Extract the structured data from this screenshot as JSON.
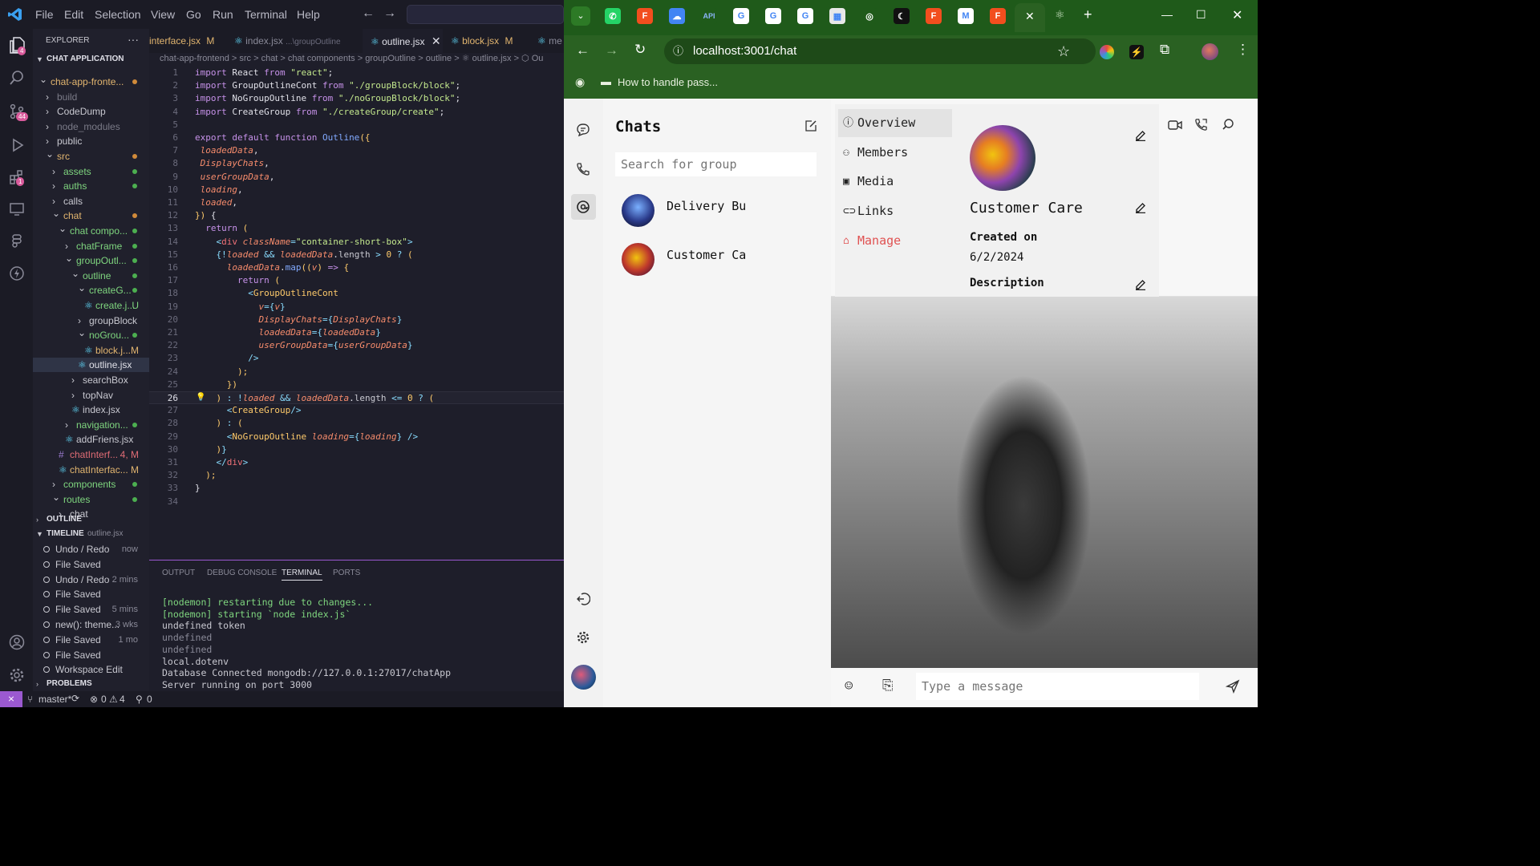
{
  "vscode": {
    "menu": [
      "File",
      "Edit",
      "Selection",
      "View",
      "Go",
      "Run",
      "Terminal",
      "Help"
    ],
    "activity_badges": {
      "explorer": "4",
      "source_control": "44",
      "extensions": "1"
    },
    "explorer": {
      "title": "EXPLORER",
      "more": "···",
      "workspace": "CHAT APPLICATION",
      "tree": [
        {
          "label": "chat-app-fronte...",
          "indent": 0,
          "open": true,
          "dot": "#d08a3a",
          "color": "#e2b56f"
        },
        {
          "label": "build",
          "indent": 1,
          "open": false,
          "dot": "",
          "color": "#7b7b88"
        },
        {
          "label": "CodeDump",
          "indent": 1,
          "open": false,
          "dot": "",
          "color": "#c8c8d0"
        },
        {
          "label": "node_modules",
          "indent": 1,
          "open": false,
          "dot": "",
          "color": "#7b7b88"
        },
        {
          "label": "public",
          "indent": 1,
          "open": false,
          "dot": "",
          "color": "#c8c8d0"
        },
        {
          "label": "src",
          "indent": 1,
          "open": true,
          "dot": "#d08a3a",
          "color": "#e2b56f"
        },
        {
          "label": "assets",
          "indent": 2,
          "open": false,
          "dot": "#4caf50",
          "color": "#7fd67f"
        },
        {
          "label": "auths",
          "indent": 2,
          "open": false,
          "dot": "#4caf50",
          "color": "#7fd67f"
        },
        {
          "label": "calls",
          "indent": 2,
          "open": false,
          "dot": "",
          "color": "#c8c8d0"
        },
        {
          "label": "chat",
          "indent": 2,
          "open": true,
          "dot": "#d08a3a",
          "color": "#e2b56f"
        },
        {
          "label": "chat compo...",
          "indent": 3,
          "open": true,
          "dot": "#4caf50",
          "color": "#7fd67f"
        },
        {
          "label": "chatFrame",
          "indent": 4,
          "open": false,
          "dot": "#4caf50",
          "color": "#7fd67f"
        },
        {
          "label": "groupOutl...",
          "indent": 4,
          "open": true,
          "dot": "#4caf50",
          "color": "#7fd67f"
        },
        {
          "label": "outline",
          "indent": 5,
          "open": true,
          "dot": "#4caf50",
          "color": "#7fd67f"
        },
        {
          "label": "createG...",
          "indent": 6,
          "open": true,
          "dot": "#4caf50",
          "color": "#7fd67f"
        },
        {
          "label": "create.j...",
          "indent": 7,
          "file": true,
          "badge": "U",
          "color": "#7fd67f"
        },
        {
          "label": "groupBlock",
          "indent": 6,
          "open": false,
          "dot": "",
          "color": "#c8c8d0"
        },
        {
          "label": "noGrou...",
          "indent": 6,
          "open": true,
          "dot": "#4caf50",
          "color": "#7fd67f"
        },
        {
          "label": "block.j...",
          "indent": 7,
          "file": true,
          "badge": "M",
          "color": "#e2b56f"
        },
        {
          "label": "outline.jsx",
          "indent": 6,
          "file": true,
          "badge": "",
          "color": "#e0e0e8",
          "selected": true
        },
        {
          "label": "searchBox",
          "indent": 5,
          "open": false,
          "dot": "",
          "color": "#c8c8d0"
        },
        {
          "label": "topNav",
          "indent": 5,
          "open": false,
          "dot": "",
          "color": "#c8c8d0"
        },
        {
          "label": "index.jsx",
          "indent": 5,
          "file": true,
          "badge": "",
          "color": "#c8c8d0"
        },
        {
          "label": "navigation...",
          "indent": 4,
          "open": false,
          "dot": "#4caf50",
          "color": "#7fd67f"
        },
        {
          "label": "addFriens.jsx",
          "indent": 4,
          "file": true,
          "badge": "",
          "color": "#c8c8d0"
        },
        {
          "label": "chatInterf...",
          "indent": 3,
          "file": true,
          "badge": "4, M",
          "color": "#e06c75",
          "hash": true
        },
        {
          "label": "chatInterfac...",
          "indent": 3,
          "file": true,
          "badge": "M",
          "color": "#e2b56f"
        },
        {
          "label": "components",
          "indent": 2,
          "open": false,
          "dot": "#4caf50",
          "color": "#7fd67f"
        },
        {
          "label": "routes",
          "indent": 2,
          "open": true,
          "dot": "#4caf50",
          "color": "#7fd67f"
        },
        {
          "label": "chat",
          "indent": 3,
          "open": false,
          "dot": "",
          "color": "#c8c8d0"
        }
      ],
      "outline": "OUTLINE",
      "timeline": "TIMELINE",
      "timeline_file": "outline.jsx",
      "timeline_items": [
        {
          "text": "Undo / Redo",
          "time": "now"
        },
        {
          "text": "File Saved",
          "time": ""
        },
        {
          "text": "Undo / Redo",
          "time": "2 mins"
        },
        {
          "text": "File Saved",
          "time": ""
        },
        {
          "text": "File Saved",
          "time": "5 mins"
        },
        {
          "text": "new(): theme...",
          "time": "3 wks"
        },
        {
          "text": "File Saved",
          "time": "1 mo"
        },
        {
          "text": "File Saved",
          "time": ""
        },
        {
          "text": "Workspace Edit",
          "time": ""
        }
      ],
      "problems": "PROBLEMS"
    },
    "tabs": [
      {
        "label": "interface.jsx",
        "suffix": "M",
        "active": false
      },
      {
        "label": "index.jsx",
        "suffix": "...\\groupOutline",
        "active": false
      },
      {
        "label": "outline.jsx",
        "suffix": "",
        "active": true
      },
      {
        "label": "block.jsx",
        "suffix": "M",
        "active": false
      },
      {
        "label": "me",
        "suffix": "",
        "active": false
      }
    ],
    "breadcrumb": "chat-app-frontend > src > chat > chat components > groupOutline > outline > ⚛ outline.jsx > ⬡ Ou",
    "code": [
      [
        [
          "kw",
          "import"
        ],
        [
          "p",
          " React "
        ],
        [
          "kw",
          "from"
        ],
        [
          "s",
          " \"react\""
        ],
        [
          "p",
          ";"
        ]
      ],
      [
        [
          "kw",
          "import"
        ],
        [
          "p",
          " GroupOutlineCont "
        ],
        [
          "kw",
          "from"
        ],
        [
          "s",
          " \"./groupBlock/block\""
        ],
        [
          "p",
          ";"
        ]
      ],
      [
        [
          "kw",
          "import"
        ],
        [
          "p",
          " NoGroupOutline "
        ],
        [
          "kw",
          "from"
        ],
        [
          "s",
          " \"./noGroupBlock/block\""
        ],
        [
          "p",
          ";"
        ]
      ],
      [
        [
          "kw",
          "import"
        ],
        [
          "p",
          " CreateGroup "
        ],
        [
          "kw",
          "from"
        ],
        [
          "s",
          " \"./createGroup/create\""
        ],
        [
          "p",
          ";"
        ]
      ],
      [],
      [
        [
          "kw",
          "export default function"
        ],
        [
          "f",
          " Outline"
        ],
        [
          "t",
          "({"
        ]
      ],
      [
        [
          "i",
          " loadedData"
        ],
        [
          "p",
          ","
        ]
      ],
      [
        [
          "i",
          " DisplayChats"
        ],
        [
          "p",
          ","
        ]
      ],
      [
        [
          "i",
          " userGroupData"
        ],
        [
          "p",
          ","
        ]
      ],
      [
        [
          "i",
          " loading"
        ],
        [
          "p",
          ","
        ]
      ],
      [
        [
          "i",
          " loaded"
        ],
        [
          "p",
          ","
        ]
      ],
      [
        [
          "t",
          "})"
        ],
        [
          "p",
          " {"
        ]
      ],
      [
        [
          "kw",
          "  return"
        ],
        [
          "t",
          " ("
        ]
      ],
      [
        [
          "o",
          "    <"
        ],
        [
          "k",
          "div"
        ],
        [
          "i",
          " className"
        ],
        [
          "o",
          "="
        ],
        [
          "s",
          "\"container-short-box\""
        ],
        [
          "o",
          ">"
        ]
      ],
      [
        [
          "c",
          "    {"
        ],
        [
          "o",
          "!"
        ],
        [
          "i",
          "loaded"
        ],
        [
          "o",
          " && "
        ],
        [
          "i",
          "loadedData"
        ],
        [
          "p",
          "."
        ],
        [
          "pl",
          "length"
        ],
        [
          "o",
          " > "
        ],
        [
          "t",
          "0"
        ],
        [
          "o",
          " ? "
        ],
        [
          "t",
          "("
        ]
      ],
      [
        [
          "i",
          "      loadedData"
        ],
        [
          "p",
          "."
        ],
        [
          "f",
          "map"
        ],
        [
          "t",
          "(("
        ],
        [
          "i",
          "v"
        ],
        [
          "t",
          ")"
        ],
        [
          "kw",
          " =>"
        ],
        [
          "t",
          " {"
        ]
      ],
      [
        [
          "kw",
          "        return"
        ],
        [
          "t",
          " ("
        ]
      ],
      [
        [
          "o",
          "          <"
        ],
        [
          "t",
          "GroupOutlineCont"
        ]
      ],
      [
        [
          "i",
          "            v"
        ],
        [
          "o",
          "="
        ],
        [
          "c",
          "{"
        ],
        [
          "i",
          "v"
        ],
        [
          "c",
          "}"
        ]
      ],
      [
        [
          "i",
          "            DisplayChats"
        ],
        [
          "o",
          "="
        ],
        [
          "c",
          "{"
        ],
        [
          "i",
          "DisplayChats"
        ],
        [
          "c",
          "}"
        ]
      ],
      [
        [
          "i",
          "            loadedData"
        ],
        [
          "o",
          "="
        ],
        [
          "c",
          "{"
        ],
        [
          "i",
          "loadedData"
        ],
        [
          "c",
          "}"
        ]
      ],
      [
        [
          "i",
          "            userGroupData"
        ],
        [
          "o",
          "="
        ],
        [
          "c",
          "{"
        ],
        [
          "i",
          "userGroupData"
        ],
        [
          "c",
          "}"
        ]
      ],
      [
        [
          "o",
          "          />"
        ]
      ],
      [
        [
          "t",
          "        );"
        ]
      ],
      [
        [
          "t",
          "      })"
        ]
      ],
      [
        [
          "t",
          "    ) "
        ],
        [
          "o",
          ": !"
        ],
        [
          "i",
          "loaded"
        ],
        [
          "o",
          " && "
        ],
        [
          "i",
          "loadedData"
        ],
        [
          "p",
          "."
        ],
        [
          "pl",
          "length"
        ],
        [
          "o",
          " <= "
        ],
        [
          "t",
          "0"
        ],
        [
          "o",
          " ? "
        ],
        [
          "t",
          "("
        ]
      ],
      [
        [
          "o",
          "      <"
        ],
        [
          "t",
          "CreateGroup"
        ],
        [
          "o",
          "/>"
        ]
      ],
      [
        [
          "t",
          "    ) "
        ],
        [
          "o",
          ": "
        ],
        [
          "t",
          "("
        ]
      ],
      [
        [
          "o",
          "      <"
        ],
        [
          "t",
          "NoGroupOutline"
        ],
        [
          "i",
          " loading"
        ],
        [
          "o",
          "="
        ],
        [
          "c",
          "{"
        ],
        [
          "i",
          "loading"
        ],
        [
          "c",
          "}"
        ],
        [
          "o",
          " />"
        ]
      ],
      [
        [
          "t",
          "    )"
        ],
        [
          "c",
          "}"
        ]
      ],
      [
        [
          "o",
          "    </"
        ],
        [
          "k",
          "div"
        ],
        [
          "o",
          ">"
        ]
      ],
      [
        [
          "t",
          "  );"
        ]
      ],
      [
        [
          "p",
          "}"
        ]
      ],
      []
    ],
    "panel_tabs": [
      "OUTPUT",
      "DEBUG CONSOLE",
      "TERMINAL",
      "PORTS"
    ],
    "terminal": [
      {
        "text": "[nodemon] restarting due to changes...",
        "color": "#7fd67f"
      },
      {
        "text": "[nodemon] starting `node index.js`",
        "color": "#7fd67f"
      },
      {
        "text": "undefined token",
        "color": "#c8c8d0"
      },
      {
        "text": "undefined",
        "color": "#8a8a98"
      },
      {
        "text": "undefined",
        "color": "#8a8a98"
      },
      {
        "text": "local.dotenv",
        "color": "#c8c8d0"
      },
      {
        "text": "Database Connected mongodb://127.0.0.1:27017/chatApp",
        "color": "#c8c8d0"
      },
      {
        "text": "Server running on port 3000",
        "color": "#c8c8d0"
      }
    ],
    "status": {
      "branch": "master*",
      "errors": "0",
      "warnings": "4",
      "ports": "0"
    }
  },
  "chrome": {
    "url": "localhost:3001/chat",
    "bookmark": "How to handle pass...",
    "tab_icons": [
      {
        "name": "whatsapp-icon",
        "bg": "#25d366",
        "glyph": "✆"
      },
      {
        "name": "figma-icon",
        "bg": "#f24e1e",
        "glyph": "F"
      },
      {
        "name": "cloud-icon",
        "bg": "#4285f4",
        "glyph": "☁"
      },
      {
        "name": "api-icon",
        "bg": "#1f5a1a",
        "glyph": "API"
      },
      {
        "name": "google-icon",
        "bg": "#ffffff",
        "glyph": "G"
      },
      {
        "name": "google-icon",
        "bg": "#ffffff",
        "glyph": "G"
      },
      {
        "name": "google-icon",
        "bg": "#ffffff",
        "glyph": "G"
      },
      {
        "name": "chart-icon",
        "bg": "#e8e8e8",
        "glyph": "▦"
      },
      {
        "name": "openai-icon",
        "bg": "#1f5a1a",
        "glyph": "◎"
      },
      {
        "name": "moon-icon",
        "bg": "#111111",
        "glyph": "☾"
      },
      {
        "name": "figma-icon",
        "bg": "#f24e1e",
        "glyph": "F"
      },
      {
        "name": "gmail-icon",
        "bg": "#ffffff",
        "glyph": "M"
      },
      {
        "name": "figma-icon",
        "bg": "#f24e1e",
        "glyph": "F"
      }
    ]
  },
  "app": {
    "chats_title": "Chats",
    "search_placeholder": "Search for group",
    "chats": [
      {
        "name": "Delivery Bu"
      },
      {
        "name": "Customer Ca"
      }
    ],
    "overlay": {
      "nav": [
        {
          "label": "Overview",
          "icon": "info-icon",
          "active": true,
          "color": "#222222"
        },
        {
          "label": "Members",
          "icon": "members-icon",
          "active": false,
          "color": "#222222"
        },
        {
          "label": "Media",
          "icon": "image-icon",
          "active": false,
          "color": "#222222"
        },
        {
          "label": "Links",
          "icon": "link-icon",
          "active": false,
          "color": "#222222"
        },
        {
          "label": "Manage",
          "icon": "bank-icon",
          "active": false,
          "color": "#e05252"
        }
      ],
      "group_name": "Customer Care",
      "created_label": "Created on",
      "created_date": "6/2/2024",
      "description_label": "Description"
    },
    "message_placeholder": "Type a message"
  }
}
